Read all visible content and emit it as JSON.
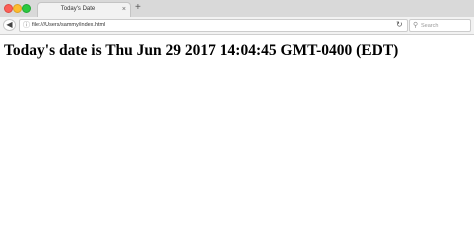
{
  "tab": {
    "title": "Today's Date",
    "close_symbol": "×",
    "new_tab_symbol": "+"
  },
  "toolbar": {
    "back_symbol": "◀",
    "url": "file:///Users/sammy/index.html",
    "page_icon_symbol": "ⓘ",
    "reload_symbol": "↻",
    "search_icon_symbol": "⚲",
    "search_placeholder": "Search"
  },
  "content": {
    "heading": "Today's date is Thu Jun 29 2017 14:04:45 GMT-0400 (EDT)"
  }
}
